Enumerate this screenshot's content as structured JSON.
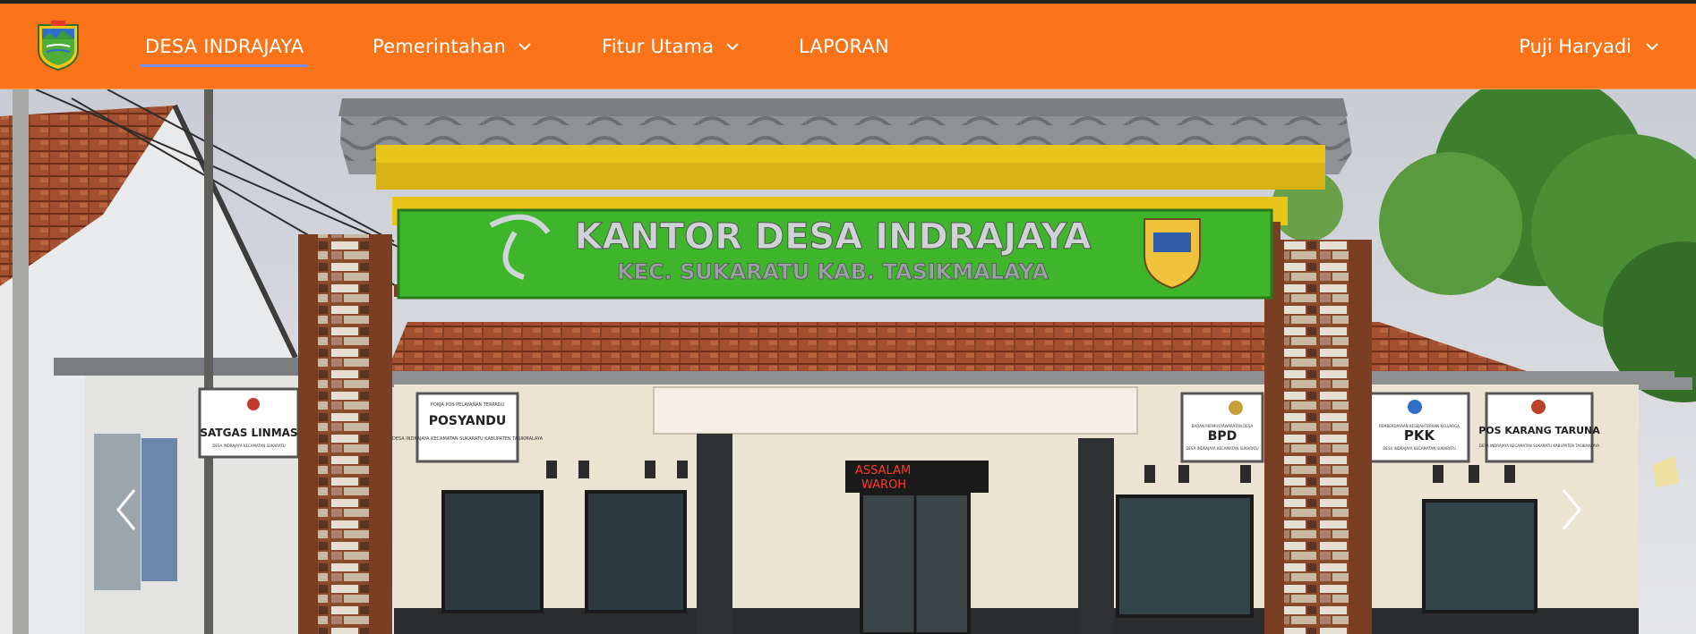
{
  "nav": {
    "brand": "DESA INDRAJAYA",
    "items": [
      {
        "label": "Pemerintahan",
        "has_dropdown": true
      },
      {
        "label": "Fitur Utama",
        "has_dropdown": true
      },
      {
        "label": "LAPORAN",
        "has_dropdown": false
      }
    ],
    "user": {
      "name": "Puji Haryadi",
      "has_dropdown": true
    }
  },
  "hero": {
    "sign_line1": "KANTOR DESA INDRAJAYA",
    "sign_line2": "KEC. SUKARATU KAB. TASIKMALAYA",
    "posters": [
      {
        "title": "SATGAS LINMAS",
        "subtitle": "DESA INDRAJAYA KECAMATAN SUKARATU"
      },
      {
        "header": "POKJA POS PELAYANAN TERPADU",
        "title": "POSYANDU",
        "subtitle": "DESA INDRAJAYA KECAMATAN SUKARATU KABUPATEN TASIKMALAYA"
      },
      {
        "header": "BADAN PERMUSYAWARATAN DESA",
        "title": "BPD",
        "subtitle": "DESA INDRAJAYA KECAMATAN SUKARATU"
      },
      {
        "header": "PEMBERDAYAAN KESEJAHTERAAN KELUARGA",
        "title": "PKK",
        "subtitle": "DESA INDRAJAYA KECAMATAN SUKARATU"
      },
      {
        "header": "",
        "title": "POS KARANG TARUNA",
        "subtitle": "DESA INDRAJAYA KECAMATAN SUKARATU KABUPATEN TASIKMALAYA"
      }
    ],
    "led_line1": "ASSALAM",
    "led_line2": "WAROH",
    "colors": {
      "navbar": "#fb7318",
      "sign_green": "#3fb52b",
      "roof_yellow": "#e8c51a",
      "tile": "#a2502f"
    }
  },
  "carousel": {
    "prev_icon": "chevron-left-icon",
    "next_icon": "chevron-right-icon"
  }
}
